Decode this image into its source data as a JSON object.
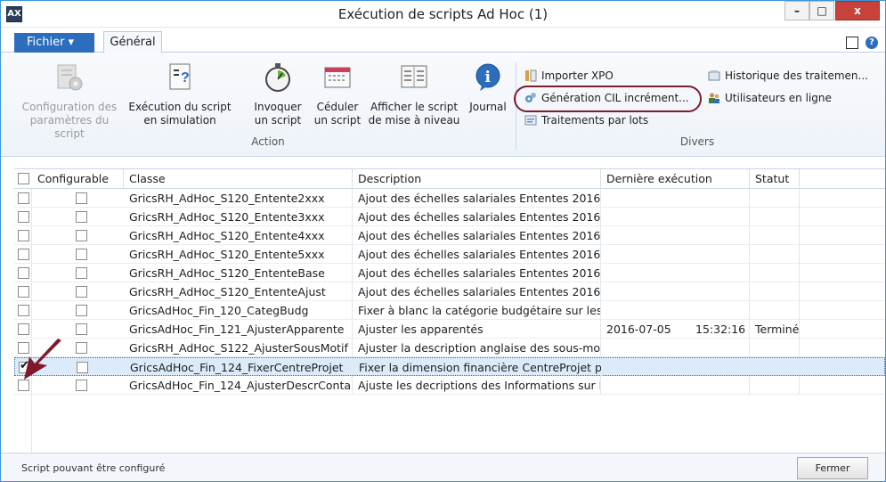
{
  "window": {
    "title": "Exécution de scripts Ad Hoc (1)",
    "minimize": "–",
    "maximize": "□",
    "close": "x"
  },
  "tabs": {
    "file": "Fichier ▾",
    "general": "Général"
  },
  "ribbon": {
    "action_group": {
      "label": "Action",
      "buttons": [
        {
          "label1": "Configuration des",
          "label2": "paramètres du script",
          "icon": "settings-doc-icon",
          "disabled": true
        },
        {
          "label1": "Exécution du script",
          "label2": "en simulation",
          "icon": "help-doc-icon",
          "disabled": false
        },
        {
          "label1": "Invoquer",
          "label2": "un script",
          "icon": "stopwatch-icon",
          "disabled": false
        },
        {
          "label1": "Céduler",
          "label2": "un script",
          "icon": "calendar-icon",
          "disabled": false
        },
        {
          "label1": "Afficher le script",
          "label2": "de mise à niveau",
          "icon": "document-icon",
          "disabled": false
        },
        {
          "label1": "Journal",
          "label2": "",
          "icon": "info-icon",
          "disabled": false
        }
      ]
    },
    "divers_group": {
      "label": "Divers",
      "items": [
        {
          "label": "Importer XPO",
          "icon": "import-icon"
        },
        {
          "label": "Génération CIL incrément...",
          "icon": "gears-icon"
        },
        {
          "label": "Traitements par lots",
          "icon": "batch-icon"
        },
        {
          "label": "Historique des traitemen...",
          "icon": "history-icon"
        },
        {
          "label": "Utilisateurs en ligne",
          "icon": "users-icon"
        }
      ]
    }
  },
  "grid": {
    "columns": [
      "Configurable",
      "Classe",
      "Description",
      "Dernière exécution",
      "Statut"
    ],
    "rows": [
      {
        "classe": "GricsRH_AdHoc_S120_Entente2xxx",
        "description": "Ajout des échelles salariales Ententes 2016 -...",
        "date": "",
        "time": "",
        "statut": "",
        "selected": false,
        "checked": false
      },
      {
        "classe": "GricsRH_AdHoc_S120_Entente3xxx",
        "description": "Ajout des échelles salariales Ententes 2016 -...",
        "date": "",
        "time": "",
        "statut": "",
        "selected": false,
        "checked": false
      },
      {
        "classe": "GricsRH_AdHoc_S120_Entente4xxx",
        "description": "Ajout des échelles salariales Ententes 2016 -...",
        "date": "",
        "time": "",
        "statut": "",
        "selected": false,
        "checked": false
      },
      {
        "classe": "GricsRH_AdHoc_S120_Entente5xxx",
        "description": "Ajout des échelles salariales Ententes 2016 -...",
        "date": "",
        "time": "",
        "statut": "",
        "selected": false,
        "checked": false
      },
      {
        "classe": "GricsRH_AdHoc_S120_EntenteBase",
        "description": "Ajout des échelles salariales Ententes 2016 -...",
        "date": "",
        "time": "",
        "statut": "",
        "selected": false,
        "checked": false
      },
      {
        "classe": "GricsRH_AdHoc_S120_EntenteAjust",
        "description": "Ajout des échelles salariales Ententes 2016 -...",
        "date": "",
        "time": "",
        "statut": "",
        "selected": false,
        "checked": false
      },
      {
        "classe": "GricsAdHoc_Fin_120_CategBudg",
        "description": "Fixer à blanc la catégorie budgétaire sur les ...",
        "date": "",
        "time": "",
        "statut": "",
        "selected": false,
        "checked": false
      },
      {
        "classe": "GricsAdHoc_Fin_121_AjusterApparente",
        "description": "Ajuster les apparentés",
        "date": "2016-07-05",
        "time": "15:32:16",
        "statut": "Terminé",
        "selected": false,
        "checked": false
      },
      {
        "classe": "GricsRH_AdHoc_S122_AjusterSousMotif",
        "description": "Ajuster la description anglaise des sous-mo...",
        "date": "",
        "time": "",
        "statut": "",
        "selected": false,
        "checked": false
      },
      {
        "classe": "GricsAdHoc_Fin_124_FixerCentreProjet",
        "description": "Fixer la dimension financière CentreProjet p...",
        "date": "",
        "time": "",
        "statut": "",
        "selected": true,
        "checked": true
      },
      {
        "classe": "GricsAdHoc_Fin_124_AjusterDescrConta...",
        "description": "Ajuste les decriptions des Informations sur l...",
        "date": "",
        "time": "",
        "statut": "",
        "selected": false,
        "checked": false
      }
    ]
  },
  "status": {
    "text": "Script pouvant être configuré",
    "close_button": "Fermer"
  },
  "colors": {
    "accent": "#2d6dbd",
    "close": "#c6423a",
    "highlight_oval": "#7e1a2c",
    "selection": "#dcebf9",
    "arrow": "#7e1a2c"
  }
}
